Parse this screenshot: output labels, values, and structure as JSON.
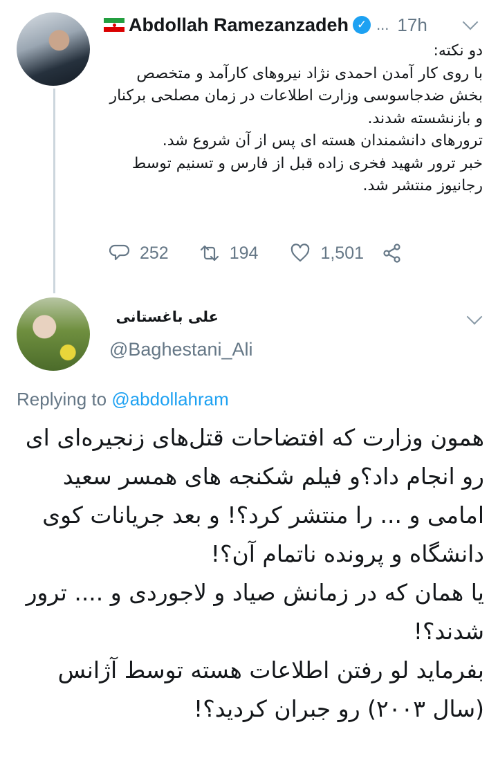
{
  "tweet": {
    "author_name": "Abdollah Ramezanzadeh",
    "more_dots": "...",
    "time": "17h",
    "text": "دو نکته:\nبا روی کار آمدن احمدی نژاد نیروهای کارآمد و متخصص بخش ضدجاسوسی وزارت اطلاعات در زمان مصلحی برکنار و بازنشسته شدند.\nترورهای دانشمندان هسته ای پس از آن شروع شد.\nخبر ترور شهید فخری زاده قبل از فارس و تسنیم توسط رجانیوز منتشر شد.",
    "replies": "252",
    "retweets": "194",
    "likes": "1,501",
    "icons": [
      "flag-icon",
      "verified-icon",
      "chevron-down-icon",
      "reply-icon",
      "retweet-icon",
      "like-icon",
      "share-icon"
    ],
    "colors": {
      "verified": "#1da1f2",
      "secondary": "#657786",
      "thread": "#ccd6dd"
    }
  },
  "reply": {
    "author_name": "علی باغستانی",
    "handle": "@Baghestani_Ali",
    "replying_label": "Replying to",
    "replying_handle": "@abdollahram",
    "text": "همون وزارت که افتضاحات قتل‌های زنجیره‌ای ای رو انجام داد؟و فیلم شکنجه های همسر سعید امامی و ... را منتشر کرد؟! و بعد جریانات کوی دانشگاه و پرونده ناتمام آن؟!\nیا همان که در زمانش صیاد و لاجوردی و .... ترور شدند؟!\nبفرماید لو رفتن اطلاعات هسته توسط آژانس (سال ۲۰۰۳) رو جبران کردید؟!",
    "colors": {
      "link": "#1da1f2"
    }
  }
}
